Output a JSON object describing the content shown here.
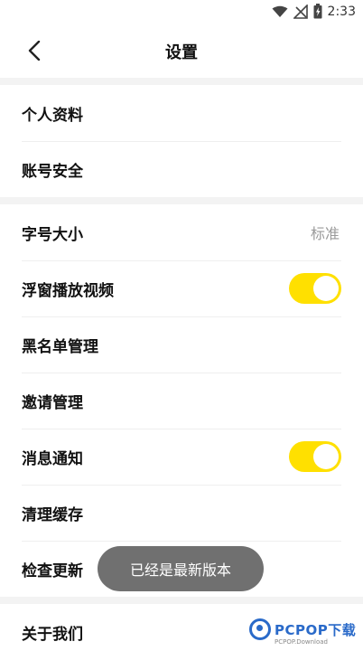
{
  "status_bar": {
    "time": "2:33",
    "icons": [
      "wifi-icon",
      "no-signal-icon",
      "battery-charging-icon"
    ]
  },
  "header": {
    "title": "设置",
    "back_icon": "chevron-left-icon"
  },
  "section1": [
    {
      "label": "个人资料"
    },
    {
      "label": "账号安全"
    }
  ],
  "section2": [
    {
      "label": "字号大小",
      "value": "标准"
    },
    {
      "label": "浮窗播放视频",
      "toggle": true
    },
    {
      "label": "黑名单管理"
    },
    {
      "label": "邀请管理"
    },
    {
      "label": "消息通知",
      "toggle": true
    },
    {
      "label": "清理缓存"
    },
    {
      "label": "检查更新"
    }
  ],
  "section3": [
    {
      "label": "关于我们"
    }
  ],
  "toast": {
    "text": "已经是最新版本"
  },
  "watermark": {
    "brand": "PCPOP下载",
    "sub": "PCPOP.Download"
  },
  "colors": {
    "toggle_on": "#ffe000",
    "divider": "#f3f3f3",
    "watermark": "#2a6ac9"
  }
}
